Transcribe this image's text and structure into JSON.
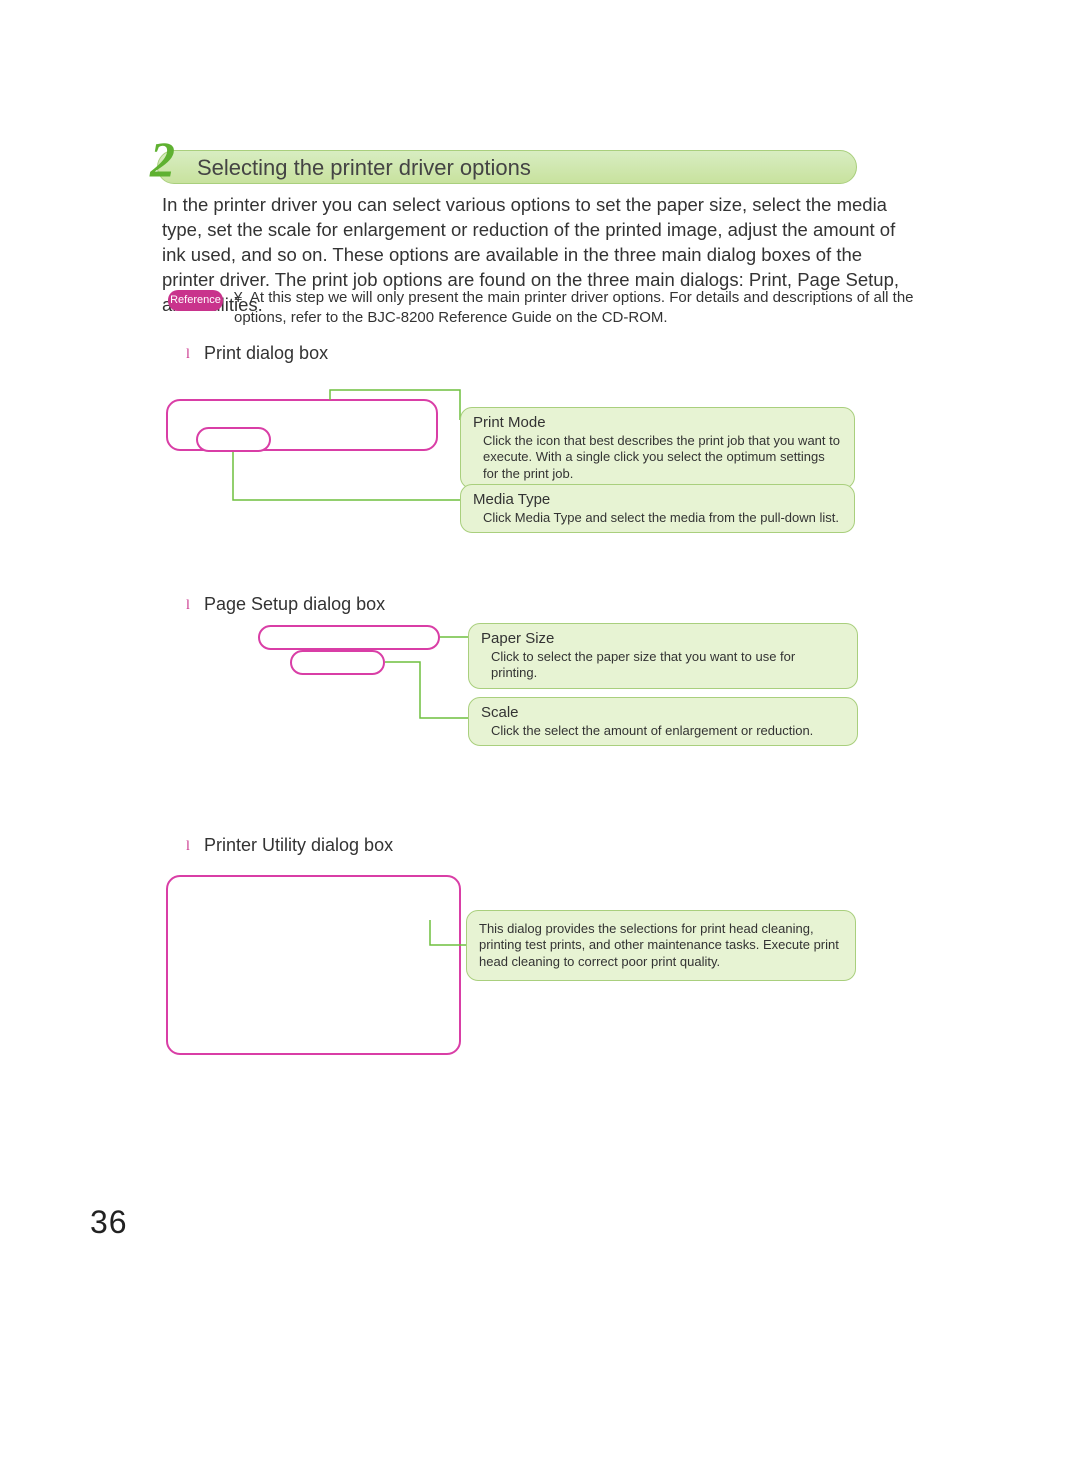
{
  "header": {
    "number": "2",
    "title": "Selecting the printer driver options"
  },
  "intro": "In the printer driver you can select various options to set the paper size, select the media type, set the scale for enlargement or reduction of the printed image, adjust the amount of ink used, and so on. These options are available in the three main dialog boxes of the printer driver. The print job options are found on the three main dialogs: Print, Page Setup, and Utilities.",
  "reference": {
    "badge": "Reference",
    "bullet": "¥",
    "text": "At this step we will only present the main printer driver options. For details and descriptions of all the options, refer to the  BJC-8200 Reference Guide  on the CD-ROM."
  },
  "sections": [
    {
      "marker": "l",
      "title": "Print dialog box",
      "callouts": [
        {
          "head": "Print Mode",
          "body": "Click the icon that best describes the print job that you want to execute. With a single click you select the optimum settings for the print job."
        },
        {
          "head": "Media Type",
          "body": "Click Media Type and select the media from the pull-down list."
        }
      ]
    },
    {
      "marker": "l",
      "title": "Page Setup dialog box",
      "callouts": [
        {
          "head": "Paper Size",
          "body": "Click to select the paper size that you want to use for printing."
        },
        {
          "head": "Scale",
          "body": "Click the select the amount of enlargement or reduction."
        }
      ]
    },
    {
      "marker": "l",
      "title": "Printer Utility dialog box",
      "callouts": [
        {
          "head": "",
          "body": "This dialog provides the selections for print head cleaning, printing test prints, and other maintenance tasks. Execute print head cleaning to correct poor print quality."
        }
      ]
    }
  ],
  "page_number": "36"
}
